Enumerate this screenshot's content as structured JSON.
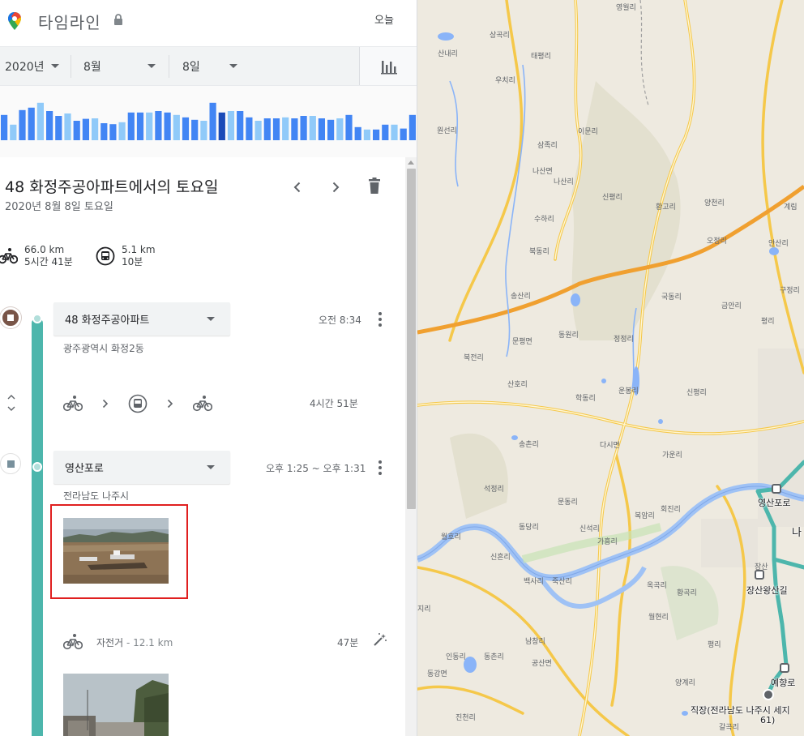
{
  "header": {
    "title": "타임라인",
    "today_label": "오늘"
  },
  "date_filter": {
    "year": "2020년",
    "month": "8월",
    "day": "8일"
  },
  "histogram": {
    "values": [
      0.52,
      0.32,
      0.62,
      0.67,
      0.77,
      0.6,
      0.5,
      0.55,
      0.4,
      0.44,
      0.45,
      0.35,
      0.33,
      0.37,
      0.57,
      0.57,
      0.57,
      0.6,
      0.57,
      0.52,
      0.47,
      0.42,
      0.4,
      0.77,
      0.57,
      0.6,
      0.6,
      0.47,
      0.4,
      0.45,
      0.45,
      0.47,
      0.45,
      0.5,
      0.5,
      0.45,
      0.42,
      0.45,
      0.52,
      0.27,
      0.22,
      0.22,
      0.32,
      0.32,
      0.24,
      0.52
    ],
    "selected_index": 24,
    "colors": {
      "normal": "#4285f4",
      "light": "#90caf9",
      "selected": "#1a4bb8"
    }
  },
  "day": {
    "title": "48 화정주공아파트에서의 토요일",
    "subtitle": "2020년 8월 8일 토요일"
  },
  "summary": {
    "bike": {
      "icon": "bike-icon",
      "distance": "66.0 km",
      "duration": "5시간 41분"
    },
    "bus": {
      "icon": "bus-icon",
      "distance": "5.1 km",
      "duration": "10분"
    }
  },
  "timeline": {
    "place1": {
      "name": "48 화정주공아파트",
      "address": "광주광역시 화정2동",
      "time": "오전 8:34"
    },
    "segment1": {
      "modes": [
        "bike-icon",
        "bus-icon",
        "bike-icon"
      ],
      "duration": "4시간 51분"
    },
    "place2": {
      "name": "영산포로",
      "address": "전라남도 나주시",
      "time": "오후 1:25 ~ 오후 1:31"
    },
    "segment2": {
      "mode": "자전거",
      "distance": "- 12.1 km",
      "duration": "47분"
    }
  },
  "map": {
    "labels": [
      "영월리",
      "상곡리",
      "산내리",
      "태평리",
      "우치리",
      "원선리",
      "이문리",
      "삼족리",
      "나산면",
      "나산리",
      "신평리",
      "수하리",
      "황고리",
      "양천리",
      "계림",
      "북동리",
      "오정리",
      "안산리",
      "송산리",
      "국동리",
      "금안리",
      "구정리",
      "문평면",
      "동원리",
      "정정리",
      "평리",
      "북전리",
      "학동리",
      "신평리",
      "산호리",
      "운봉리",
      "송촌리",
      "다시면",
      "가운리",
      "석정리",
      "회진리",
      "문동리",
      "동당리",
      "신석리",
      "복암리",
      "월호리",
      "가흥리",
      "신흔리",
      "백사리",
      "죽산리",
      "옥곡리",
      "황곡리",
      "월현리",
      "남창리",
      "인동리",
      "동촌리",
      "공산면",
      "양계리",
      "동강면",
      "진천리",
      "평리",
      "갈곡리",
      "지리"
    ],
    "route_labels": [
      "영산포로",
      "장산왕산길",
      "예향로",
      "직장(전라남도 나주시 세지",
      "61)",
      "나",
      "장산"
    ]
  }
}
